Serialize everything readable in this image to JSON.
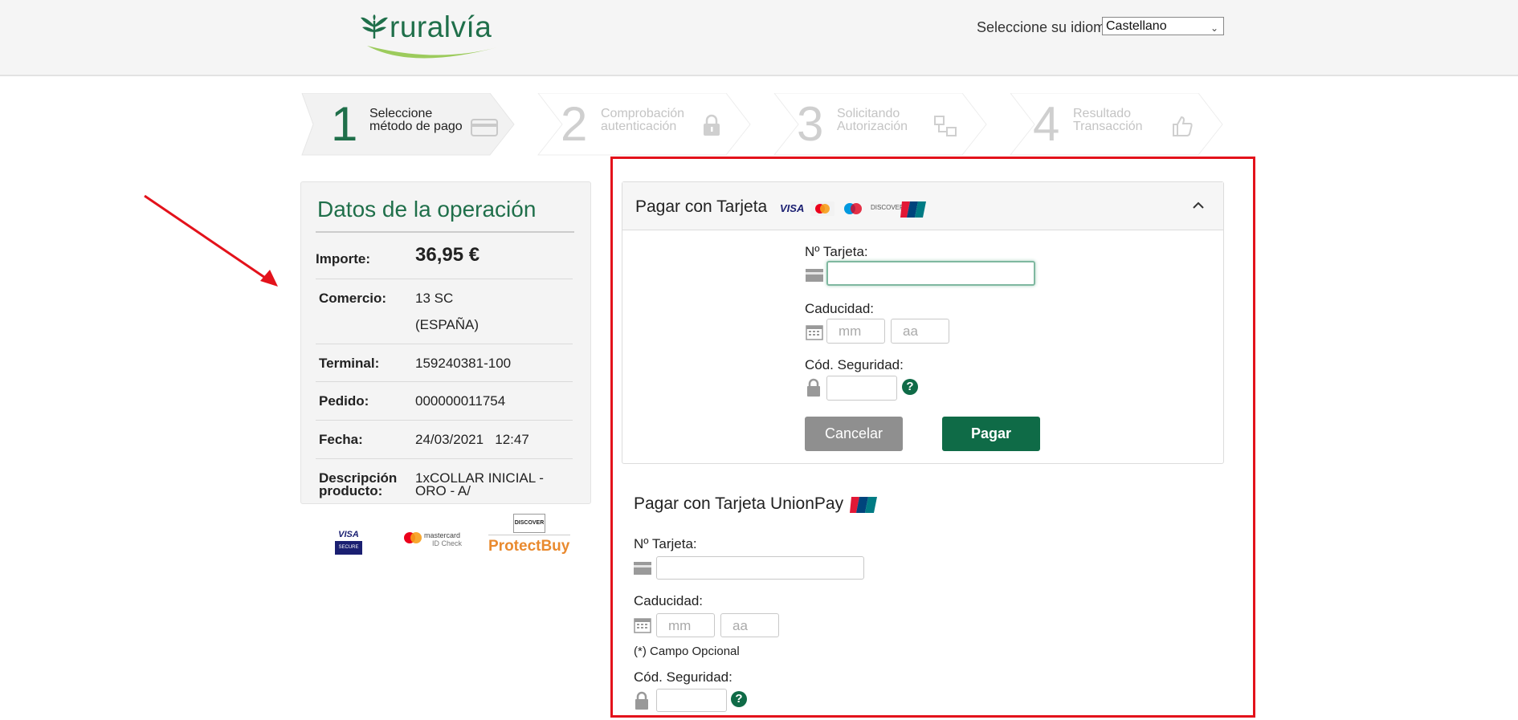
{
  "header": {
    "logo_text": "ruralvía",
    "language_label": "Seleccione su idioma",
    "language_value": "Castellano"
  },
  "steps": [
    {
      "num": "1",
      "line1": "Seleccione",
      "line2": "método de pago",
      "icon": "card-icon",
      "state": "active"
    },
    {
      "num": "2",
      "line1": "Comprobación",
      "line2": "autenticación",
      "icon": "padlock-icon",
      "state": "inactive"
    },
    {
      "num": "3",
      "line1": "Solicitando",
      "line2": "Autorización",
      "icon": "network-icon",
      "state": "inactive"
    },
    {
      "num": "4",
      "line1": "Resultado",
      "line2": "Transacción",
      "icon": "thumbs-up-icon",
      "state": "inactive"
    }
  ],
  "summary": {
    "title": "Datos de la operación",
    "importe_label": "Importe:",
    "importe_value": "36,95 €",
    "comercio_label": "Comercio:",
    "comercio_value_1": "13 SC",
    "comercio_value_2": "(ESPAÑA)",
    "terminal_label": "Terminal:",
    "terminal_value": "159240381-100",
    "pedido_label": "Pedido:",
    "pedido_value": "000000011754",
    "fecha_label": "Fecha:",
    "fecha_value": "24/03/2021   12:47",
    "descripcion_label_1": "Descripción",
    "descripcion_label_2": "producto:",
    "descripcion_value_1": "1xCOLLAR INICIAL -",
    "descripcion_value_2": "ORO - A/"
  },
  "security_badges": {
    "visa_secure_line1": "VISA",
    "visa_secure_line2": "SECURE",
    "mc_line1": "mastercard",
    "mc_line2": "ID Check",
    "discover": "DISCOVER",
    "protectbuy": "ProtectBuy"
  },
  "card_payment": {
    "title": "Pagar con Tarjeta",
    "brands": [
      "VISA",
      "Mastercard",
      "Maestro",
      "DISCOVER",
      "UnionPay"
    ],
    "card_number_label": "Nº Tarjeta:",
    "card_number_value": "",
    "expiry_label": "Caducidad:",
    "expiry_month_placeholder": "mm",
    "expiry_year_placeholder": "aa",
    "cvv_label": "Cód. Seguridad:",
    "help_symbol": "?",
    "cancel_label": "Cancelar",
    "pay_label": "Pagar"
  },
  "unionpay_payment": {
    "title": "Pagar con Tarjeta UnionPay",
    "card_number_label": "Nº Tarjeta:",
    "expiry_label": "Caducidad:",
    "expiry_month_placeholder": "mm",
    "expiry_year_placeholder": "aa",
    "optional_note": "(*) Campo Opcional",
    "cvv_label": "Cód. Seguridad:",
    "help_symbol": "?"
  },
  "colors": {
    "brand_green": "#0f6b47",
    "highlight_red": "#e3121b",
    "cancel_gray": "#8f8f8f"
  }
}
